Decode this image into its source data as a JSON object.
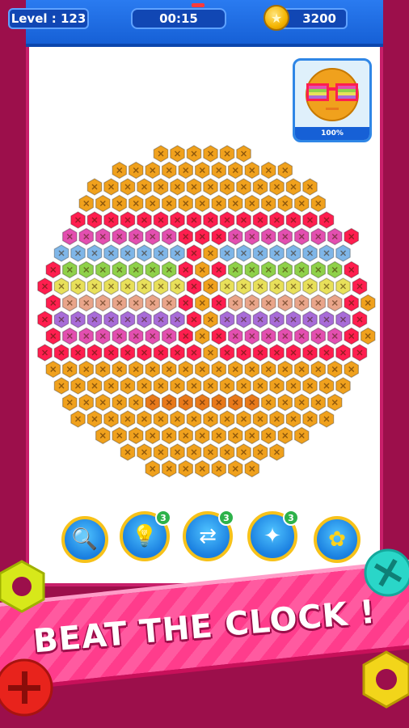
{
  "hud": {
    "level_label": "Level : 123",
    "timer": "00:15",
    "coins": "3200"
  },
  "preview": {
    "progress_label": "100%",
    "progress_value": 100
  },
  "tools": [
    {
      "name": "magnifier-nut-tool",
      "icon": "magnifier-icon",
      "badge": ""
    },
    {
      "name": "hint-tool",
      "icon": "lightbulb-icon",
      "badge": "3"
    },
    {
      "name": "shuffle-tool",
      "icon": "shuffle-icon",
      "badge": "3"
    },
    {
      "name": "magic-tool",
      "icon": "magic-arrows-icon",
      "badge": "3"
    },
    {
      "name": "settings-tool",
      "icon": "gear-icon",
      "badge": ""
    }
  ],
  "banner": {
    "text": "BEAT THE CLOCK !"
  },
  "colors": {
    "face": "#f0a11d",
    "frame": "#ff1e4f",
    "pink": "#e34fb0",
    "blue": "#7fb6e8",
    "green": "#8fd14a",
    "yellow": "#e8e05a",
    "peach": "#e9a58a",
    "purple": "#a86cd8",
    "mouth": "#e8791a"
  }
}
